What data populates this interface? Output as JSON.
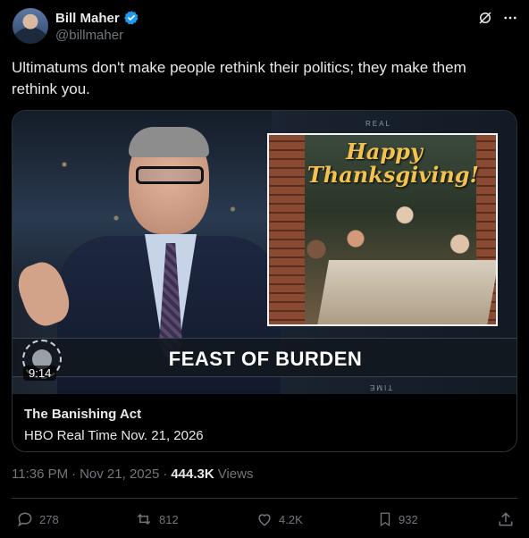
{
  "author": {
    "display_name": "Bill Maher",
    "handle": "@billmaher"
  },
  "tweet": {
    "text": "Ultimatums don't make people rethink their politics; they make them rethink you."
  },
  "media": {
    "inset_text_line1": "Happy",
    "inset_text_line2": "Thanksgiving!",
    "show_segment_title": "FEAST OF BURDEN",
    "real_tag": "REAL",
    "time_tag": "TIME",
    "duration": "9:14"
  },
  "card": {
    "title": "The Banishing Act",
    "subtitle": "HBO Real Time Nov. 21, 2026"
  },
  "meta": {
    "time": "11:36 PM",
    "date": "Nov 21, 2025",
    "separator": "·",
    "views_count": "444.3K",
    "views_label": "Views"
  },
  "actions": {
    "replies": "278",
    "reposts": "812",
    "likes": "4.2K",
    "bookmarks": "932"
  },
  "icons": {
    "verified": "verified-badge-icon",
    "grok": "grok-icon",
    "more": "more-icon",
    "reply": "reply-icon",
    "repost": "repost-icon",
    "like": "like-icon",
    "bookmark": "bookmark-icon",
    "share": "share-icon"
  },
  "colors": {
    "background": "#000000",
    "text": "#e7e9ea",
    "muted": "#71767b",
    "border": "#2f3336",
    "verified": "#1d9bf0"
  }
}
